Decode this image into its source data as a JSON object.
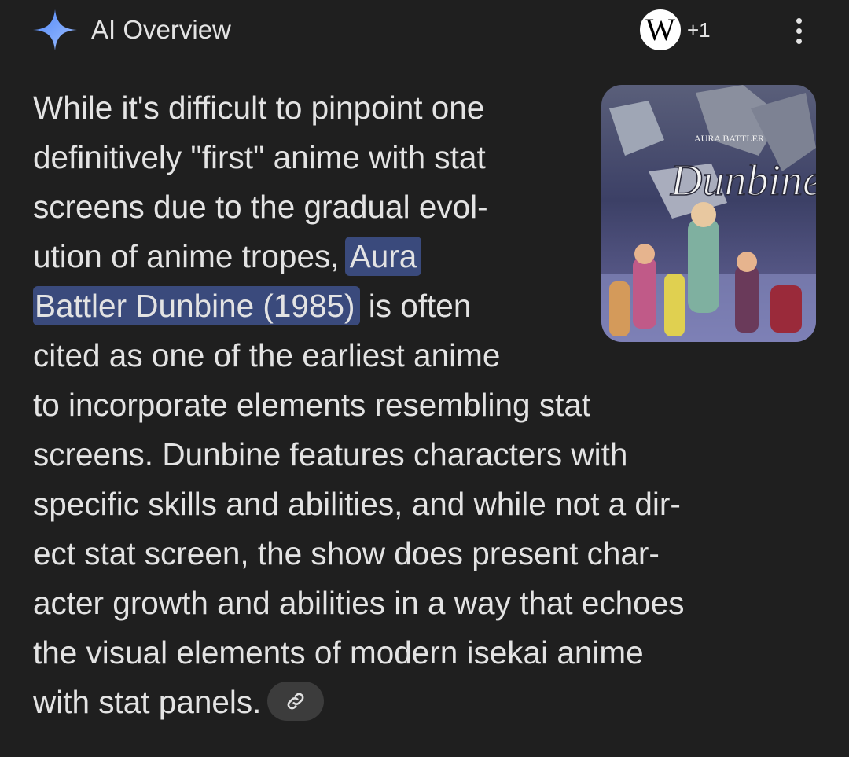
{
  "header": {
    "title": "AI Overview",
    "sparkle_icon": "sparkle-icon",
    "sources": {
      "badge_letter": "W",
      "count_label": "+1",
      "icon": "wikipedia-icon"
    },
    "more_icon": "more-vert-icon"
  },
  "thumbnail": {
    "logo_top": "AURA BATTLER",
    "logo_main": "Dunbine"
  },
  "body": {
    "lines": [
      "While it's difficult to pinpoint one",
      "definitively \"first\" anime with stat",
      "screens due to the gradual evol-",
      "ution of anime tropes, ",
      "is often",
      "cited as one of the earliest anime",
      "to incorporate elements resembling stat",
      "screens. Dunbine features characters with",
      "specific skills and abilities, and while not a dir-",
      "ect stat screen, the show does present char-",
      "acter growth and abilities in a way that echoes",
      "the visual elements of modern isekai anime",
      "with stat panels."
    ],
    "highlight_part1": "Aura",
    "highlight_part2": "Battler Dunbine (1985)"
  },
  "link_chip": {
    "icon": "link-icon"
  },
  "colors": {
    "background": "#1f1f1f",
    "text": "#e3e3e3",
    "highlight": "#3a4a7c",
    "sparkle": "#8ab4f8",
    "chip": "#3c3c3c"
  }
}
